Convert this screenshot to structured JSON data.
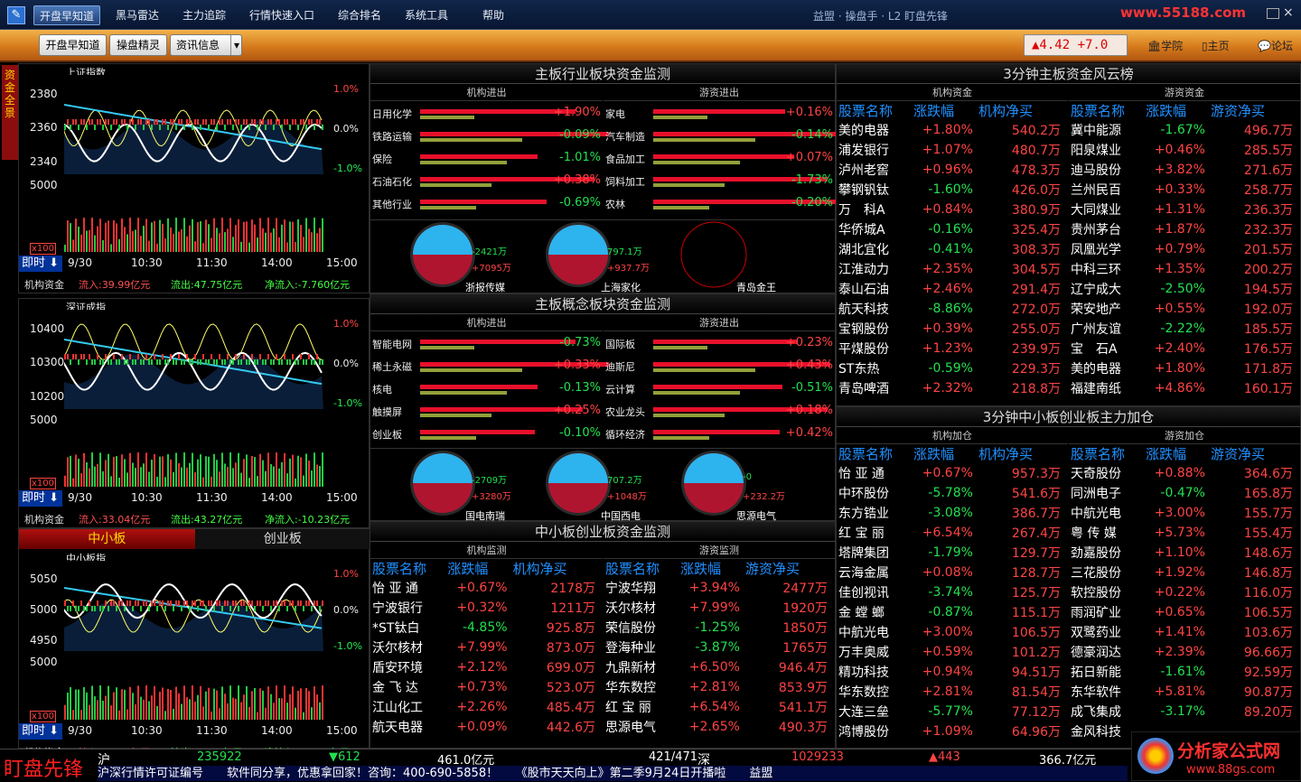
{
  "menu": {
    "items": [
      "开盘早知道",
      "黑马雷达",
      "主力追踪",
      "行情快速入口",
      "综合排名",
      "系统工具",
      "帮助"
    ],
    "title": "益盟 · 操盘手 · L2 盯盘先锋"
  },
  "watermark": "www.55188.com",
  "toolbar": {
    "buttons": [
      "开盘早知道",
      "操盘精灵",
      "资讯信息"
    ],
    "index_value": "▲4.42 +7.0",
    "links": [
      "学院",
      "主页",
      "论坛"
    ]
  },
  "vtab": "资金全景",
  "mini_charts": [
    {
      "name": "上证指数",
      "y": [
        "2380",
        "2360",
        "2340"
      ],
      "pct": [
        "1.0%",
        "0.0%",
        "-1.0%"
      ],
      "vol": "5000",
      "mult": "x100",
      "period": "即时",
      "times": [
        "9/30",
        "10:30",
        "11:30",
        "14:00",
        "15:00"
      ],
      "flow": {
        "label": "机构资金",
        "in": "流入:39.99亿元",
        "out": "流出:47.75亿元",
        "net": "净流入:-7.760亿元"
      }
    },
    {
      "name": "深证成指",
      "y": [
        "10400",
        "10300",
        "10200"
      ],
      "pct": [
        "1.0%",
        "0.0%",
        "-1.0%"
      ],
      "vol": "5000",
      "mult": "x100",
      "period": "即时",
      "times": [
        "9/30",
        "10:30",
        "11:30",
        "14:00",
        "15:00"
      ],
      "flow": {
        "label": "机构资金",
        "in": "流入:33.04亿元",
        "out": "流出:43.27亿元",
        "net": "净流入:-10.23亿元"
      }
    },
    {
      "name": "中小板指",
      "y": [
        "5050",
        "5000",
        "4950"
      ],
      "pct": [
        "1.0%",
        "0.0%",
        "-1.0%"
      ],
      "vol": "5000",
      "mult": "x100",
      "period": "即时",
      "times": [
        "9/30",
        "10:30",
        "11:30",
        "14:00",
        "15:00"
      ],
      "flow": {
        "label": "机构资金",
        "in": "流入:8.814亿元",
        "out": "流出:10.23亿元",
        "net": "净流入:-1.415亿元"
      }
    }
  ],
  "small_tabs": [
    "中小板",
    "创业板"
  ],
  "industry": {
    "title": "主板行业板块资金监测",
    "left_hdr": "机构进出",
    "right_hdr": "游资进出",
    "left": [
      [
        "日用化学",
        "+1.90%"
      ],
      [
        "铁路运输",
        "-0.09%"
      ],
      [
        "保险",
        "-1.01%"
      ],
      [
        "石油石化",
        "+0.38%"
      ],
      [
        "其他行业",
        "-0.69%"
      ]
    ],
    "right": [
      [
        "家电",
        "+0.16%"
      ],
      [
        "汽车制造",
        "-0.14%"
      ],
      [
        "食品加工",
        "+0.07%"
      ],
      [
        "饲料加工",
        "-1.73%"
      ],
      [
        "农林",
        "-0.20%"
      ]
    ],
    "pies": [
      {
        "out": "-2421万",
        "in": "+7095万",
        "name": "浙报传媒"
      },
      {
        "out": "797.1万",
        "in": "+937.7万",
        "name": "上海家化"
      },
      {
        "out": "",
        "in": "",
        "name": "青岛金王"
      }
    ]
  },
  "concept": {
    "title": "主板概念板块资金监测",
    "left_hdr": "机构进出",
    "right_hdr": "游资进出",
    "left": [
      [
        "智能电网",
        "-0.73%"
      ],
      [
        "稀土永磁",
        "+0.33%"
      ],
      [
        "核电",
        "-0.13%"
      ],
      [
        "触摸屏",
        "+0.25%"
      ],
      [
        "创业板",
        "-0.10%"
      ]
    ],
    "right": [
      [
        "国际板",
        "+0.23%"
      ],
      [
        "迪斯尼",
        "+0.43%"
      ],
      [
        "云计算",
        "-0.51%"
      ],
      [
        "农业龙头",
        "+0.18%"
      ],
      [
        "循环经济",
        "+0.42%"
      ]
    ],
    "pies": [
      {
        "out": "-2709万",
        "in": "+3280万",
        "name": "国电南瑞"
      },
      {
        "out": "707.2万",
        "in": "+1048万",
        "name": "中国西电"
      },
      {
        "out": "-0",
        "in": "+232.2万",
        "name": "思源电气"
      }
    ]
  },
  "sme": {
    "title": "中小板创业板资金监测",
    "left_hdr": "机构监测",
    "right_hdr": "游资监测",
    "cols_l": [
      "股票名称",
      "涨跌幅",
      "机构净买"
    ],
    "cols_r": [
      "股票名称",
      "涨跌幅",
      "游资净买"
    ],
    "left": [
      [
        "怡 亚 通",
        "+0.67%",
        "2178万"
      ],
      [
        "宁波银行",
        "+0.32%",
        "1211万"
      ],
      [
        "*ST钛白",
        "-4.85%",
        "925.8万"
      ],
      [
        "沃尔核材",
        "+7.99%",
        "873.0万"
      ],
      [
        "盾安环境",
        "+2.12%",
        "699.0万"
      ],
      [
        "金 飞 达",
        "+0.73%",
        "523.0万"
      ],
      [
        "江山化工",
        "+2.26%",
        "485.4万"
      ],
      [
        "航天电器",
        "+0.09%",
        "442.6万"
      ]
    ],
    "right": [
      [
        "宁波华翔",
        "+3.94%",
        "2477万"
      ],
      [
        "沃尔核材",
        "+7.99%",
        "1920万"
      ],
      [
        "荣信股份",
        "-1.25%",
        "1850万"
      ],
      [
        "登海种业",
        "-3.87%",
        "1765万"
      ],
      [
        "九鼎新材",
        "+6.50%",
        "946.4万"
      ],
      [
        "华东数控",
        "+2.81%",
        "853.9万"
      ],
      [
        "红 宝 丽",
        "+6.54%",
        "541.1万"
      ],
      [
        "思源电气",
        "+2.65%",
        "490.3万"
      ]
    ]
  },
  "fengyun": {
    "title": "3分钟主板资金风云榜",
    "left_hdr": "机构资金",
    "right_hdr": "游资资金",
    "cols_l": [
      "股票名称",
      "涨跌幅",
      "机构净买"
    ],
    "cols_r": [
      "股票名称",
      "涨跌幅",
      "游资净买"
    ],
    "left": [
      [
        "美的电器",
        "+1.80%",
        "540.2万"
      ],
      [
        "浦发银行",
        "+1.07%",
        "480.7万"
      ],
      [
        "泸州老窖",
        "+0.96%",
        "478.3万"
      ],
      [
        "攀钢钒钛",
        "-1.60%",
        "426.0万"
      ],
      [
        "万　科A",
        "+0.84%",
        "380.9万"
      ],
      [
        "华侨城A",
        "-0.16%",
        "325.4万"
      ],
      [
        "湖北宜化",
        "-0.41%",
        "308.3万"
      ],
      [
        "江淮动力",
        "+2.35%",
        "304.5万"
      ],
      [
        "泰山石油",
        "+2.46%",
        "291.4万"
      ],
      [
        "航天科技",
        "-8.86%",
        "272.0万"
      ],
      [
        "宝钢股份",
        "+0.39%",
        "255.0万"
      ],
      [
        "平煤股份",
        "+1.23%",
        "239.9万"
      ],
      [
        "ST东热",
        "-0.59%",
        "229.3万"
      ],
      [
        "青岛啤酒",
        "+2.32%",
        "218.8万"
      ]
    ],
    "right": [
      [
        "冀中能源",
        "-1.67%",
        "496.7万"
      ],
      [
        "阳泉煤业",
        "+0.46%",
        "285.5万"
      ],
      [
        "迪马股份",
        "+3.82%",
        "271.6万"
      ],
      [
        "兰州民百",
        "+0.33%",
        "258.7万"
      ],
      [
        "大同煤业",
        "+1.31%",
        "236.3万"
      ],
      [
        "贵州茅台",
        "+1.87%",
        "232.3万"
      ],
      [
        "凤凰光学",
        "+0.79%",
        "201.5万"
      ],
      [
        "中科三环",
        "+1.35%",
        "200.2万"
      ],
      [
        "辽宁成大",
        "-2.50%",
        "194.5万"
      ],
      [
        "荣安地产",
        "+0.55%",
        "192.0万"
      ],
      [
        "广州友谊",
        "-2.22%",
        "185.5万"
      ],
      [
        "宝　石A",
        "+2.40%",
        "176.5万"
      ],
      [
        "美的电器",
        "+1.80%",
        "171.8万"
      ],
      [
        "福建南纸",
        "+4.86%",
        "160.1万"
      ]
    ]
  },
  "zhuli": {
    "title": "3分钟中小板创业板主力加仓",
    "left_hdr": "机构加仓",
    "right_hdr": "游资加仓",
    "cols_l": [
      "股票名称",
      "涨跌幅",
      "机构净买"
    ],
    "cols_r": [
      "股票名称",
      "涨跌幅",
      "游资净买"
    ],
    "left": [
      [
        "怡 亚 通",
        "+0.67%",
        "957.3万"
      ],
      [
        "中环股份",
        "-5.78%",
        "541.6万"
      ],
      [
        "东方锆业",
        "-3.08%",
        "386.7万"
      ],
      [
        "红 宝 丽",
        "+6.54%",
        "267.4万"
      ],
      [
        "塔牌集团",
        "-1.79%",
        "129.7万"
      ],
      [
        "云海金属",
        "+0.08%",
        "128.7万"
      ],
      [
        "佳创视讯",
        "-3.74%",
        "125.7万"
      ],
      [
        "金 螳 螂",
        "-0.87%",
        "115.1万"
      ],
      [
        "中航光电",
        "+3.00%",
        "106.5万"
      ],
      [
        "万丰奥威",
        "+0.59%",
        "101.2万"
      ],
      [
        "精功科技",
        "+0.94%",
        "94.51万"
      ],
      [
        "华东数控",
        "+2.81%",
        "81.54万"
      ],
      [
        "大连三垒",
        "-5.77%",
        "77.12万"
      ],
      [
        "鸿博股份",
        "+1.09%",
        "64.96万"
      ]
    ],
    "right": [
      [
        "天奇股份",
        "+0.88%",
        "364.6万"
      ],
      [
        "同洲电子",
        "-0.47%",
        "165.8万"
      ],
      [
        "中航光电",
        "+3.00%",
        "155.7万"
      ],
      [
        "粤 传 媒",
        "+5.73%",
        "155.4万"
      ],
      [
        "劲嘉股份",
        "+1.10%",
        "148.6万"
      ],
      [
        "三花股份",
        "+1.92%",
        "146.8万"
      ],
      [
        "软控股份",
        "+0.22%",
        "116.0万"
      ],
      [
        "雨润矿业",
        "+0.65%",
        "106.5万"
      ],
      [
        "双鹭药业",
        "+1.41%",
        "103.6万"
      ],
      [
        "德豪润达",
        "+2.39%",
        "96.66万"
      ],
      [
        "拓日新能",
        "-1.61%",
        "92.59万"
      ],
      [
        "东华软件",
        "+5.81%",
        "90.87万"
      ],
      [
        "成飞集成",
        "-3.17%",
        "89.20万"
      ],
      [
        "金风科技",
        "",
        ""
      ]
    ]
  },
  "status": {
    "sh_label": "沪",
    "sh_val": "235922",
    "sh_chg": "▼612",
    "sh_amt": "461.0亿元",
    "ratio": "421/471",
    "sz_label": "深",
    "sz_val": "1029233",
    "sz_chg": "▲443",
    "sz_amt": "366.7亿元"
  },
  "ticker": "沪深行情许可证编号　　软件同分享，优惠拿回家！咨询：400-690-5858！　　《股市天天向上》第二季9月24日开播啦　　益盟",
  "brand": {
    "pioneer": "盯盘先锋",
    "site": "分析家公式网",
    "url": "www.88gs.com"
  }
}
